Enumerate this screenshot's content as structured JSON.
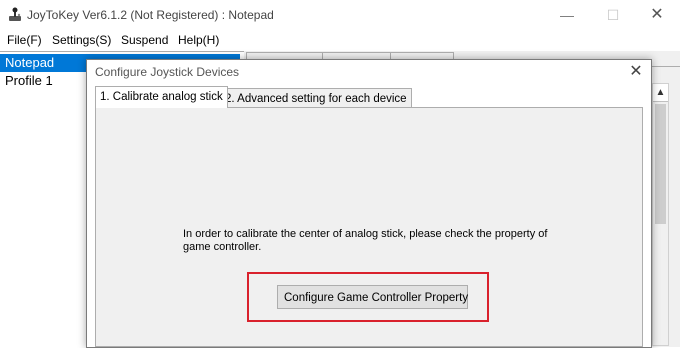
{
  "window": {
    "title": "JoyToKey Ver6.1.2 (Not Registered) : Notepad",
    "minimize_glyph": "—",
    "maximize_glyph": "☐",
    "close_glyph": "✕"
  },
  "menu": {
    "items": [
      "File(F)",
      "Settings(S)",
      "Suspend",
      "Help(H)"
    ]
  },
  "profiles": {
    "items": [
      {
        "label": "Notepad",
        "selected": true
      },
      {
        "label": "Profile 1",
        "selected": false
      }
    ]
  },
  "dialog": {
    "title": "Configure Joystick Devices",
    "close_glyph": "✕",
    "tabs": [
      {
        "label": "1. Calibrate analog stick",
        "active": true
      },
      {
        "label": "2. Advanced setting for each device",
        "active": false
      }
    ],
    "instruction": "In order to calibrate the center of analog stick, please check the property of game controller.",
    "configure_button_label": "Configure Game Controller Property"
  },
  "icons": {
    "app": "joystick-icon",
    "scroll_up": "scroll-up-arrow-icon"
  },
  "colors": {
    "selection": "#0078d7",
    "highlight": "#d9212c",
    "dialog_panel": "#f0f0f0"
  }
}
